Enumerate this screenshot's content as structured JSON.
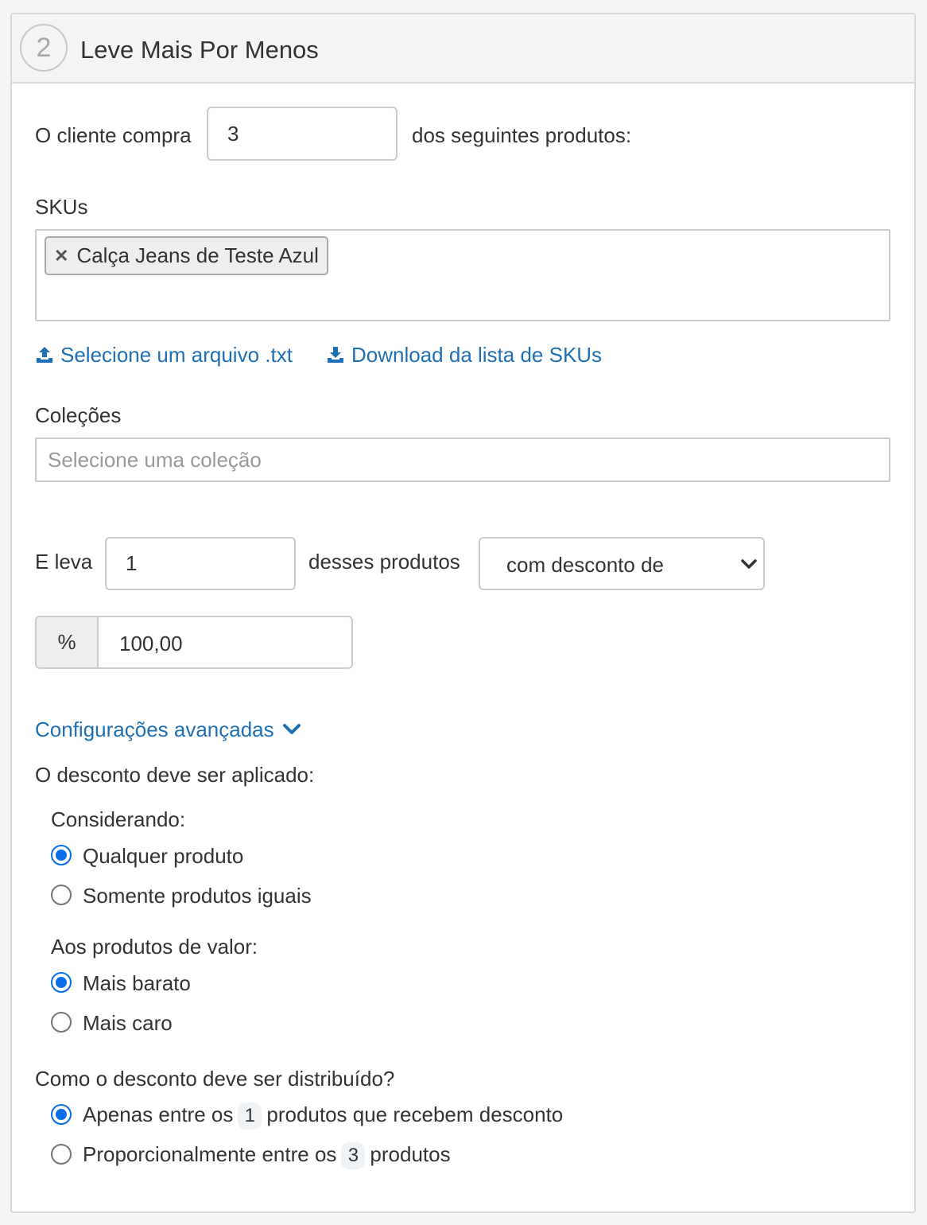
{
  "header": {
    "step_number": "2",
    "title": "Leve Mais Por Menos"
  },
  "buy": {
    "prefix": "O cliente compra",
    "quantity": "3",
    "suffix": "dos seguintes produtos:"
  },
  "skus": {
    "label": "SKUs",
    "tags": [
      "Calça Jeans de Teste Azul"
    ],
    "upload_link": "Selecione um arquivo .txt",
    "download_link": "Download da lista de SKUs"
  },
  "collections": {
    "label": "Coleções",
    "placeholder": "Selecione uma coleção"
  },
  "take": {
    "prefix": "E leva",
    "quantity": "1",
    "middle": "desses produtos",
    "mode_selected": "com desconto de"
  },
  "discount": {
    "unit": "%",
    "value": "100,00"
  },
  "advanced": {
    "toggle_label": "Configurações avançadas",
    "applied_label": "O desconto deve ser aplicado:",
    "considering": {
      "label": "Considerando:",
      "options": [
        {
          "label": "Qualquer produto",
          "checked": true
        },
        {
          "label": "Somente produtos iguais",
          "checked": false
        }
      ]
    },
    "value_group": {
      "label": "Aos produtos de valor:",
      "options": [
        {
          "label": "Mais barato",
          "checked": true
        },
        {
          "label": "Mais caro",
          "checked": false
        }
      ]
    },
    "distribution": {
      "label": "Como o desconto deve ser distribuído?",
      "option1": {
        "before": "Apenas entre os",
        "badge": "1",
        "after": "produtos que recebem desconto",
        "checked": true
      },
      "option2": {
        "before": "Proporcionalmente entre os",
        "badge": "3",
        "after": "produtos",
        "checked": false
      }
    }
  },
  "colors": {
    "link": "#1f6fb5",
    "radio_checked": "#0b6ee9",
    "border": "#cccccc"
  }
}
